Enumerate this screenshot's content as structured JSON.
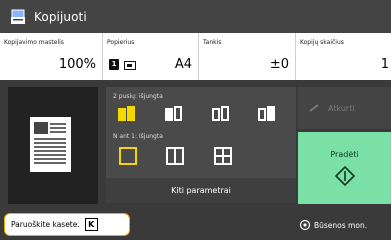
{
  "app": {
    "title": "Kopijuoti"
  },
  "info": {
    "copies_label": "Kopijavimo mastelis",
    "copies_value": "100%",
    "paper_label": "Popierius",
    "paper_badge": "1",
    "paper_value": "A4",
    "density_label": "Tankis",
    "density_value": "±0",
    "count_label": "Kopijų skaičius",
    "count_value": "1"
  },
  "options": {
    "duplex_label": "2 pusių: išjungta",
    "nup_label": "N ant 1: Išjungta",
    "more_button": "Kiti parametrai"
  },
  "actions": {
    "stop_label": "Atkurti",
    "start_label": "Pradėti"
  },
  "bottom": {
    "hint": "Paruoškite kasete.",
    "key": "K",
    "status": "Būsenos mon."
  },
  "colors": {
    "accent_yellow": "#f5d800",
    "start_green": "#7be0a6",
    "hint_border": "#f2a900"
  }
}
